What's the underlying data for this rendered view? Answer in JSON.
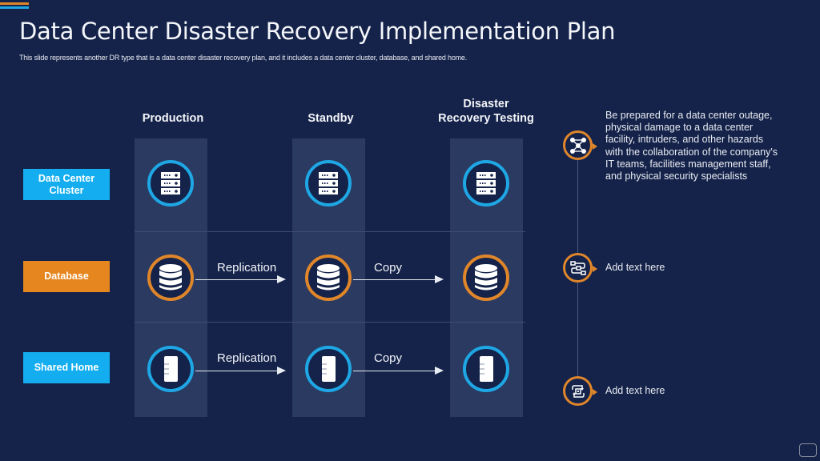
{
  "slide": {
    "title": "Data Center Disaster Recovery Implementation Plan",
    "subtitle": "This slide represents another DR type that is a data center disaster recovery plan, and it includes a data center cluster, database, and shared home."
  },
  "colors": {
    "background": "#15234a",
    "panel": "#2a3a61",
    "accent_blue": "#1ea7e4",
    "accent_orange": "#e0862a",
    "label_blue": "#14aef0",
    "label_orange": "#e6861f"
  },
  "columns": [
    {
      "label": "Production"
    },
    {
      "label": "Standby"
    },
    {
      "label_line1": "Disaster",
      "label_line2": "Recovery Testing"
    }
  ],
  "rows": [
    {
      "label_line1": "Data Center",
      "label_line2": "Cluster",
      "icon": "server-rack-icon",
      "color": "blue"
    },
    {
      "label": "Database",
      "icon": "database-icon",
      "color": "orange"
    },
    {
      "label": "Shared Home",
      "icon": "document-file-icon",
      "color": "blue"
    }
  ],
  "flows": {
    "database": [
      "Replication",
      "Copy"
    ],
    "shared_home": [
      "Replication",
      "Copy"
    ]
  },
  "timeline": [
    {
      "icon": "network-hazard-icon",
      "text": [
        "Be prepared for a data center outage,",
        "physical damage to a data center",
        "facility, intruders, and other hazards",
        "with the collaboration of the company's",
        "IT teams, facilities management staff,",
        "and physical security specialists"
      ]
    },
    {
      "icon": "workflow-icon",
      "text": "Add text here"
    },
    {
      "icon": "process-cycle-icon",
      "text": "Add text here"
    }
  ]
}
